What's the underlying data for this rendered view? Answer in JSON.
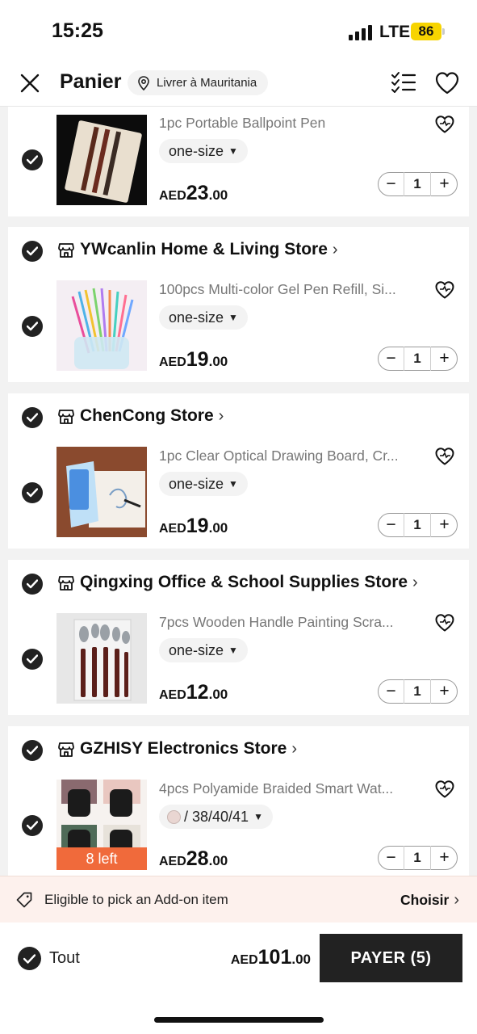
{
  "status": {
    "time": "15:25",
    "network": "LTE",
    "battery": "86"
  },
  "header": {
    "title": "Panier",
    "ship_to": "Livrer à Mauritania"
  },
  "items": [
    {
      "name": "1pc Portable Ballpoint Pen",
      "variant": "one-size",
      "price": {
        "currency": "AED",
        "int": "23",
        "dec": ".00"
      },
      "qty": "1"
    },
    {
      "store": "YWcanlin Home & Living Store",
      "name": "100pcs Multi-color Gel Pen Refill, Si...",
      "variant": "one-size",
      "price": {
        "currency": "AED",
        "int": "19",
        "dec": ".00"
      },
      "qty": "1"
    },
    {
      "store": "ChenCong Store",
      "name": "1pc Clear Optical Drawing Board, Cr...",
      "variant": "one-size",
      "price": {
        "currency": "AED",
        "int": "19",
        "dec": ".00"
      },
      "qty": "1"
    },
    {
      "store": "Qingxing Office & School Supplies Store",
      "name": "7pcs Wooden Handle Painting Scra...",
      "variant": "one-size",
      "price": {
        "currency": "AED",
        "int": "12",
        "dec": ".00"
      },
      "qty": "1"
    },
    {
      "store": "GZHISY Electronics Store",
      "name": "4pcs Polyamide Braided Smart Wat...",
      "variant": "/ 38/40/41",
      "price": {
        "currency": "AED",
        "int": "28",
        "dec": ".00"
      },
      "qty": "1",
      "stock_badge": "8 left"
    }
  ],
  "addon": {
    "text": "Eligible to pick an Add-on item",
    "action": "Choisir"
  },
  "footer": {
    "select_all": "Tout",
    "total": {
      "currency": "AED",
      "int": "101",
      "dec": ".00"
    },
    "checkout": "PAYER (5)"
  },
  "colors": {
    "accent": "#222222",
    "stock_badge": "#f06a3b",
    "addon_bg": "#fdf1ed"
  },
  "icons": {
    "close": "close-icon",
    "location": "location-pin-icon",
    "list": "checklist-icon",
    "wishlist": "heart-icon",
    "store": "store-icon",
    "move_to_wishlist": "heart-move-icon",
    "tag": "tag-icon"
  }
}
